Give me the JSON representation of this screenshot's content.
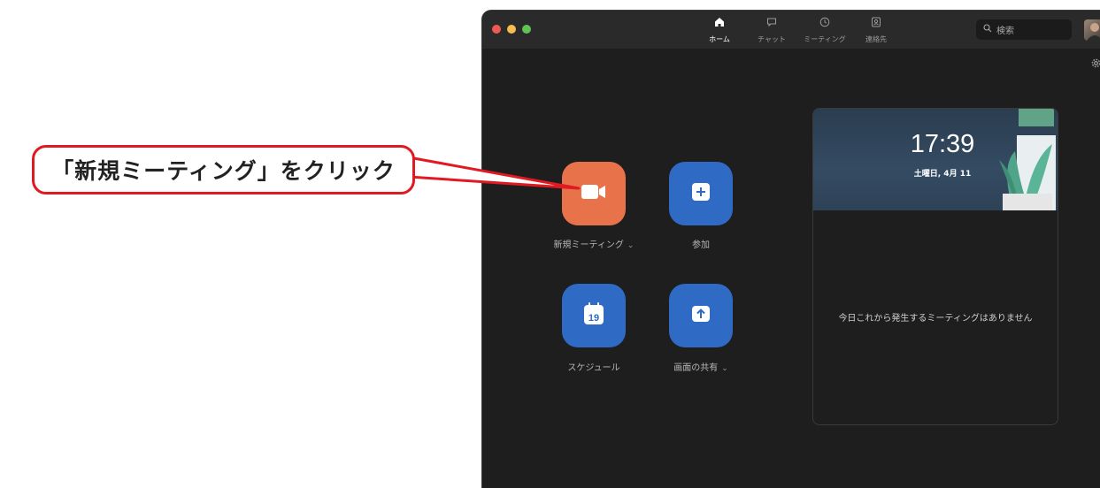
{
  "annotation": {
    "callout_text": "「新規ミーティング」をクリック"
  },
  "nav": {
    "tabs": [
      {
        "label": "ホーム",
        "icon": "home-icon",
        "active": true
      },
      {
        "label": "チャット",
        "icon": "chat-icon",
        "active": false
      },
      {
        "label": "ミーティング",
        "icon": "clock-icon",
        "active": false
      },
      {
        "label": "連絡先",
        "icon": "contacts-icon",
        "active": false
      }
    ]
  },
  "search": {
    "placeholder": "検索"
  },
  "actions": {
    "new_meeting": {
      "label": "新規ミーティング",
      "has_dropdown": true,
      "color": "#e8734a",
      "icon": "video-camera-icon"
    },
    "join": {
      "label": "参加",
      "color": "#2f6ac4",
      "icon": "plus-icon"
    },
    "schedule": {
      "label": "スケジュール",
      "color": "#2f6ac4",
      "icon": "calendar-icon",
      "calendar_day": "19"
    },
    "share_screen": {
      "label": "画面の共有",
      "has_dropdown": true,
      "color": "#2f6ac4",
      "icon": "upload-arrow-icon"
    }
  },
  "panel": {
    "time": "17:39",
    "date": "土曜日, 4月 11",
    "empty_message": "今日これから発生するミーティングはありません"
  },
  "colors": {
    "callout_border": "#e01a22",
    "window_bg": "#1e1e1e",
    "titlebar_bg": "#2a2a2a"
  }
}
